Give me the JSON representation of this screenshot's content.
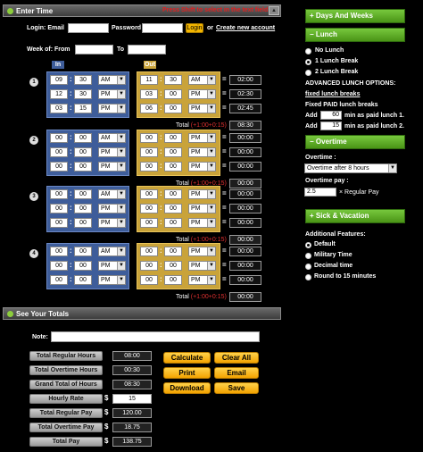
{
  "enter_time": {
    "title": "Enter Time",
    "warning": "Press Shift to select in the text field",
    "scroll": "▲",
    "login_label": "Login: Email",
    "password_label": "Password",
    "login_button": "Login",
    "or_text": "or",
    "create_account": "Create new account",
    "week_of_label": "Week of: From",
    "to_label": "To",
    "in_tag": "In",
    "out_tag": "Out",
    "total_label": "Total",
    "total_extra": "(+1:00+0:15)",
    "equals": "=",
    "colon": ":",
    "days": [
      {
        "num": "1",
        "rows": [
          {
            "in_h": "09",
            "in_m": "30",
            "in_ap": "AM",
            "out_h": "11",
            "out_m": "30",
            "out_ap": "AM",
            "result": "02:00"
          },
          {
            "in_h": "12",
            "in_m": "30",
            "in_ap": "PM",
            "out_h": "03",
            "out_m": "00",
            "out_ap": "PM",
            "result": "02:30"
          },
          {
            "in_h": "03",
            "in_m": "15",
            "in_ap": "PM",
            "out_h": "06",
            "out_m": "00",
            "out_ap": "PM",
            "result": "02:45"
          }
        ],
        "total": "08:30"
      },
      {
        "num": "2",
        "rows": [
          {
            "in_h": "00",
            "in_m": "00",
            "in_ap": "AM",
            "out_h": "00",
            "out_m": "00",
            "out_ap": "PM",
            "result": "00:00"
          },
          {
            "in_h": "00",
            "in_m": "00",
            "in_ap": "PM",
            "out_h": "00",
            "out_m": "00",
            "out_ap": "PM",
            "result": "00:00"
          },
          {
            "in_h": "00",
            "in_m": "00",
            "in_ap": "PM",
            "out_h": "00",
            "out_m": "00",
            "out_ap": "PM",
            "result": "00:00"
          }
        ],
        "total": "00:00"
      },
      {
        "num": "3",
        "rows": [
          {
            "in_h": "00",
            "in_m": "00",
            "in_ap": "AM",
            "out_h": "00",
            "out_m": "00",
            "out_ap": "PM",
            "result": "00:00"
          },
          {
            "in_h": "00",
            "in_m": "00",
            "in_ap": "PM",
            "out_h": "00",
            "out_m": "00",
            "out_ap": "PM",
            "result": "00:00"
          },
          {
            "in_h": "00",
            "in_m": "00",
            "in_ap": "PM",
            "out_h": "00",
            "out_m": "00",
            "out_ap": "PM",
            "result": "00:00"
          }
        ],
        "total": "00:00"
      },
      {
        "num": "4",
        "rows": [
          {
            "in_h": "00",
            "in_m": "00",
            "in_ap": "AM",
            "out_h": "00",
            "out_m": "00",
            "out_ap": "PM",
            "result": "00:00"
          },
          {
            "in_h": "00",
            "in_m": "00",
            "in_ap": "PM",
            "out_h": "00",
            "out_m": "00",
            "out_ap": "PM",
            "result": "00:00"
          },
          {
            "in_h": "00",
            "in_m": "00",
            "in_ap": "PM",
            "out_h": "00",
            "out_m": "00",
            "out_ap": "PM",
            "result": "00:00"
          }
        ],
        "total": "00:00"
      }
    ]
  },
  "totals": {
    "title": "See Your Totals",
    "note_label": "Note:",
    "total_regular_hours_label": "Total Regular Hours",
    "total_regular_hours": "08:00",
    "total_overtime_hours_label": "Total Overtime Hours",
    "total_overtime_hours": "00:30",
    "grand_total_label": "Grand Total of Hours",
    "grand_total": "08:30",
    "hourly_rate_label": "Hourly Rate",
    "hourly_rate": "15",
    "total_regular_pay_label": "Total Regular Pay",
    "total_regular_pay": "120.00",
    "total_overtime_pay_label": "Total Overtime Pay",
    "total_overtime_pay": "18.75",
    "total_pay_label": "Total Pay",
    "total_pay": "138.75",
    "dollar": "$",
    "buttons": {
      "calculate": "Calculate",
      "clear_all": "Clear All",
      "print": "Print",
      "email": "Email",
      "download": "Download",
      "save": "Save"
    }
  },
  "right": {
    "days_and_weeks": "+ Days And Weeks",
    "lunch": "− Lunch",
    "no_lunch": "No Lunch",
    "one_lunch": "1 Lunch Break",
    "two_lunch": "2 Lunch Break",
    "advanced_title": "ADVANCED LUNCH OPTIONS:",
    "fixed_lunch_link": "fixed lunch breaks",
    "fixed_paid": "Fixed PAID lunch breaks",
    "add1_pre": "Add",
    "add1_val": "60",
    "add1_post": "min as paid lunch 1.",
    "add2_pre": "Add",
    "add2_val": "15",
    "add2_post": "min as paid lunch 2.",
    "overtime": "− Overtime",
    "overtime_label": "Overtime :",
    "overtime_select": "Overtime after 8 hours",
    "overtime_pay_label": "Overtime pay :",
    "overtime_pay_val": "2.5",
    "overtime_pay_post": "× Regular Pay",
    "sick_vacation": "+ Sick & Vacation",
    "additional_features": "Additional Features:",
    "default": "Default",
    "military": "Military Time",
    "decimal": "Decimal time",
    "round15": "Round to 15 minutes"
  }
}
